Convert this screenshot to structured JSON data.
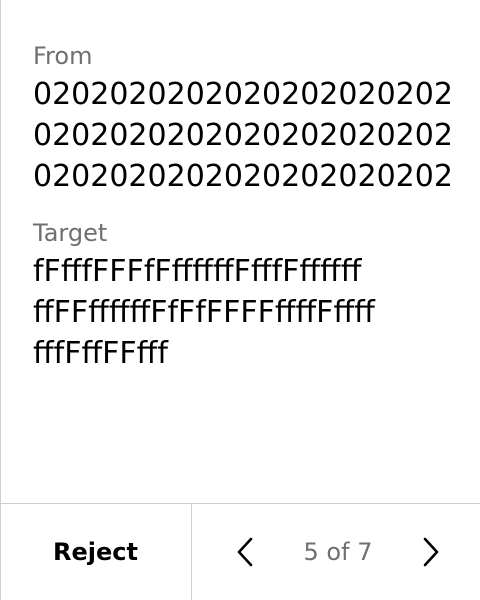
{
  "from": {
    "label": "From",
    "value": "020202020202020202020202020202020202020202020202020202020202020202"
  },
  "target": {
    "label": "Target",
    "lines": [
      "fFfffFFFfFffffffFfffFffffff",
      "ffFFffffffFfFfFFFFffffFffff",
      "fffFffFFfff"
    ]
  },
  "footer": {
    "reject_label": "Reject",
    "page_indicator": "5 of 7",
    "prev_icon": "chevron-left-icon",
    "next_icon": "chevron-right-icon"
  }
}
